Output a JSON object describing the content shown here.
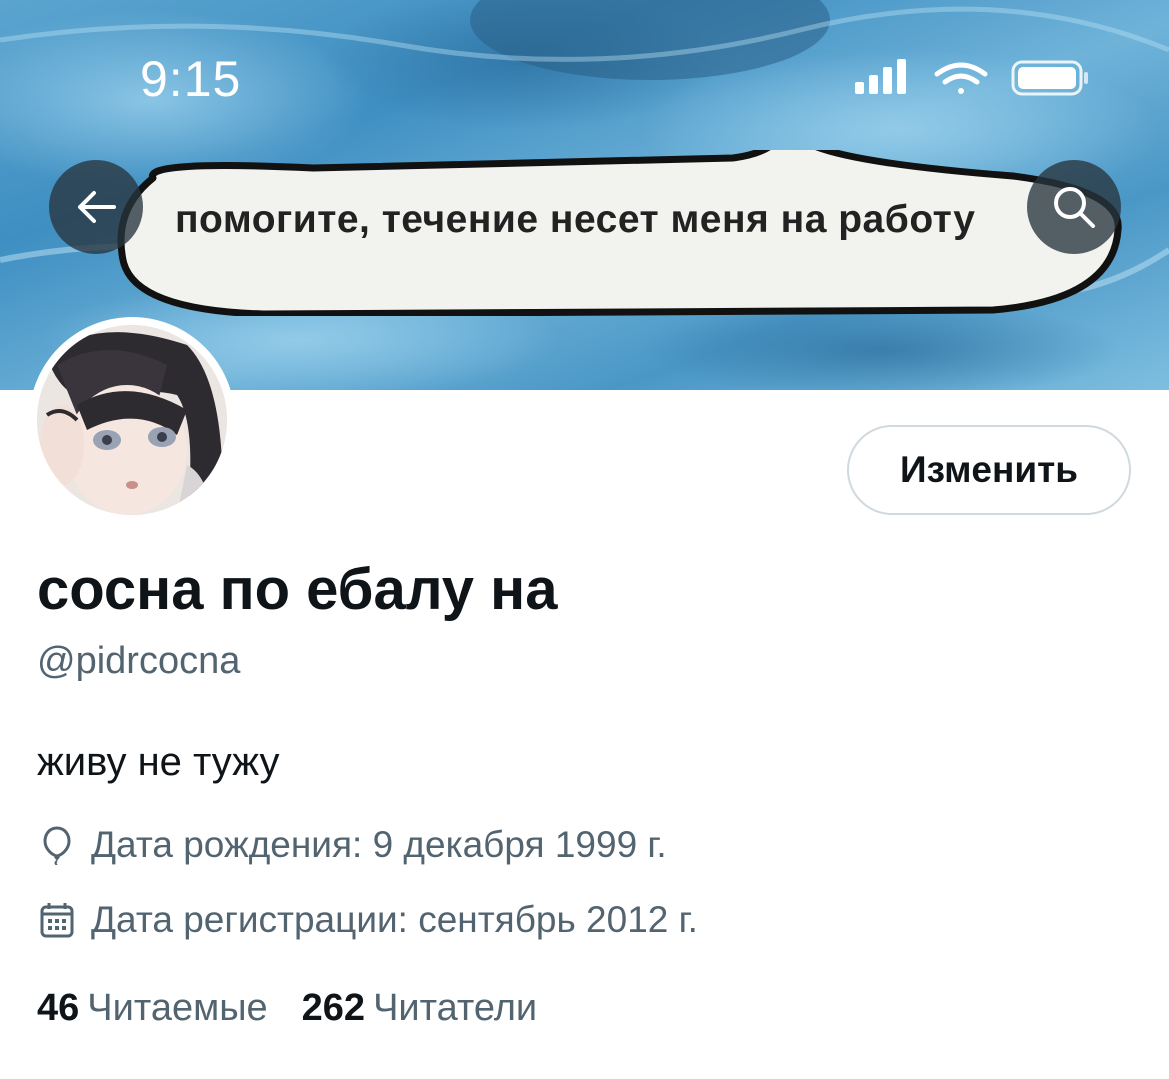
{
  "status_bar": {
    "time": "9:15"
  },
  "banner": {
    "speech_text": "помогите, течение несет меня на работу"
  },
  "nav": {
    "back_icon": "arrow-left-icon",
    "search_icon": "search-icon"
  },
  "profile": {
    "edit_label": "Изменить",
    "display_name": "сосна по ебалу на",
    "handle": "@pidrcocna",
    "bio": "живу не тужу",
    "birthday": "Дата рождения: 9 декабря 1999 г.",
    "joined": "Дата регистрации: сентябрь 2012 г.",
    "following_count": "46",
    "following_label": "Читаемые",
    "followers_count": "262",
    "followers_label": "Читатели"
  },
  "colors": {
    "text": "#0f1419",
    "secondary": "#536471",
    "border": "#cfd9de"
  }
}
